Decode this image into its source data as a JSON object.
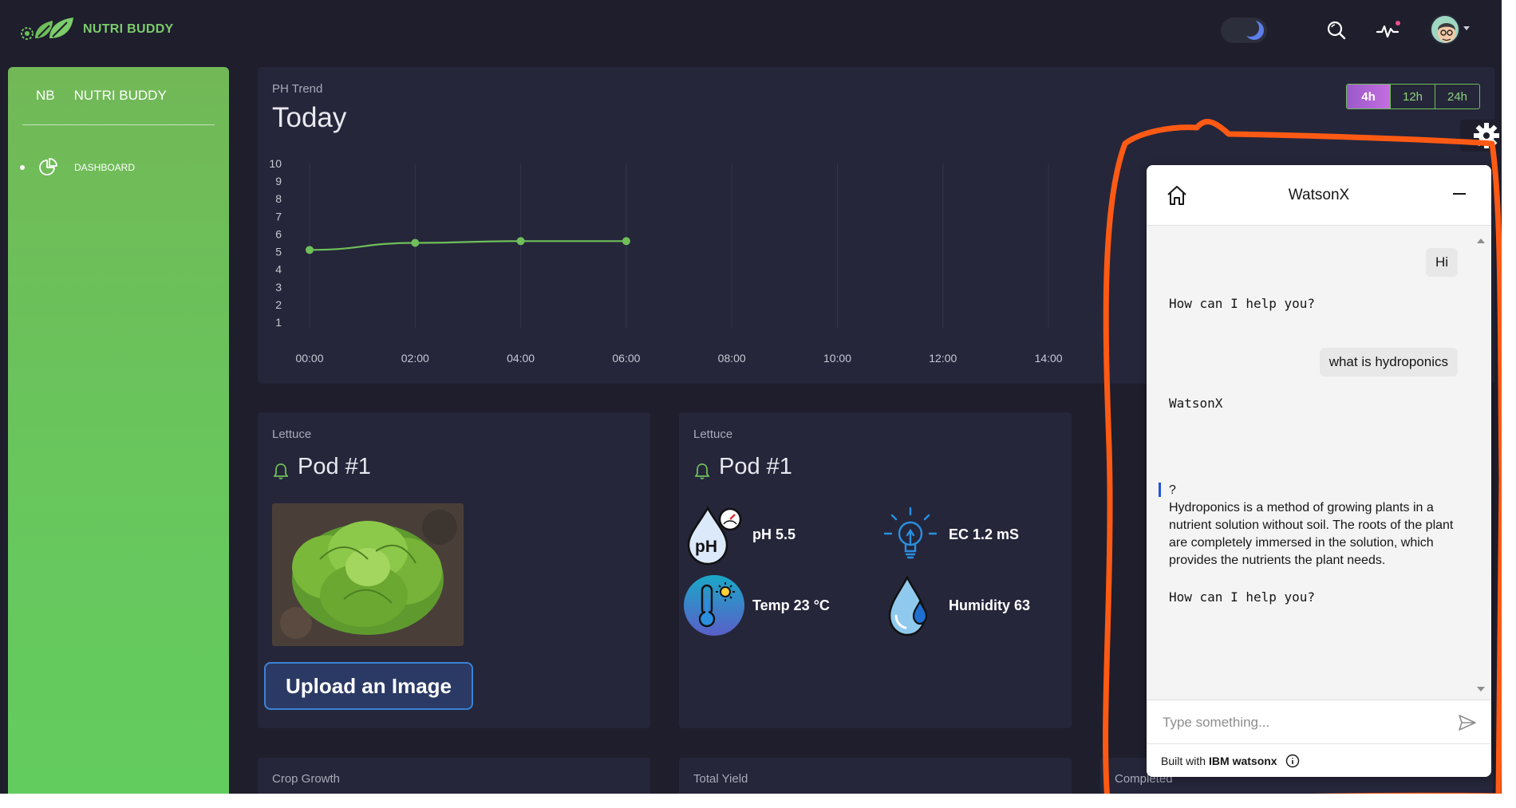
{
  "brand": {
    "name": "NUTRI BUDDY",
    "accent": "#7ccc6a"
  },
  "topbar": {
    "theme_toggle": "dark",
    "icons": [
      "search-icon",
      "activity-icon",
      "avatar"
    ]
  },
  "sidebar": {
    "abbr": "NB",
    "name": "NUTRI BUDDY",
    "items": [
      {
        "label": "DASHBOARD",
        "icon": "pie-chart-icon",
        "active": true
      }
    ]
  },
  "ph_card": {
    "kicker": "PH Trend",
    "title": "Today",
    "ranges": [
      "4h",
      "12h",
      "24h"
    ],
    "selected_range": "4h"
  },
  "chart_data": {
    "type": "line",
    "title": "",
    "xlabel": "",
    "ylabel": "",
    "x_ticks": [
      "00:00",
      "02:00",
      "04:00",
      "06:00",
      "08:00",
      "10:00",
      "12:00",
      "14:00"
    ],
    "y_ticks": [
      1,
      2,
      3,
      4,
      5,
      6,
      7,
      8,
      9,
      10
    ],
    "ylim": [
      1,
      10
    ],
    "grid": "vertical",
    "series": [
      {
        "color": "#6fbf5a",
        "x": [
          "00:00",
          "02:00",
          "04:00",
          "06:00"
        ],
        "y": [
          5.1,
          5.5,
          5.6,
          5.6
        ]
      }
    ]
  },
  "pod_image_card": {
    "kicker": "Lettuce",
    "title": "Pod #1",
    "upload_label": "Upload an Image"
  },
  "pod_metrics_card": {
    "kicker": "Lettuce",
    "title": "Pod #1",
    "metrics": [
      {
        "label": "pH 5.5",
        "icon": "ph-drop-icon"
      },
      {
        "label": "EC 1.2 mS",
        "icon": "bulb-icon"
      },
      {
        "label": "Temp 23 °C",
        "icon": "thermometer-icon"
      },
      {
        "label": "Humidity 63",
        "icon": "humidity-drop-icon"
      }
    ]
  },
  "bottom_cards": [
    "Crop Growth",
    "Total Yield",
    "Completed"
  ],
  "chat": {
    "title": "WatsonX",
    "messages": [
      {
        "role": "user",
        "text": "Hi"
      },
      {
        "role": "bot",
        "text": "How can I help you?"
      },
      {
        "role": "user",
        "text": "what is hydroponics"
      },
      {
        "role": "bot",
        "text": "WatsonX"
      },
      {
        "role": "bot",
        "text": "?"
      },
      {
        "role": "bot",
        "text": "Hydroponics is a method of growing plants in a nutrient solution without soil. The roots of the plant are completely immersed in the solution, which provides the nutrients the plant needs."
      },
      {
        "role": "bot",
        "text": "How can I help you?"
      }
    ],
    "input_placeholder": "Type something...",
    "footer_prefix": "Built with",
    "footer_brand": "IBM watsonx"
  },
  "highlight_color": "#ff5a14"
}
